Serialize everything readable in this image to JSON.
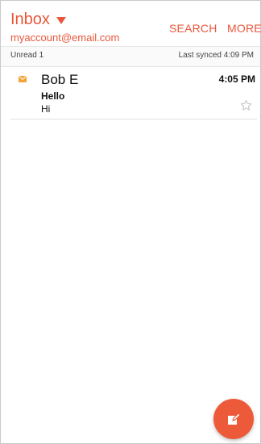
{
  "header": {
    "mailbox": "Inbox",
    "account": "myaccount@email.com",
    "search_label": "SEARCH",
    "more_label": "MORE"
  },
  "status": {
    "unread": "Unread 1",
    "last_synced": "Last synced 4:09 PM"
  },
  "messages": [
    {
      "sender": "Bob E",
      "time": "4:05 PM",
      "subject": "Hello",
      "preview": "Hi",
      "icon": "envelope-icon",
      "starred": false
    }
  ],
  "compose": {
    "icon": "compose-icon"
  },
  "colors": {
    "accent": "#e8573a",
    "fab": "#ed5a3a"
  }
}
